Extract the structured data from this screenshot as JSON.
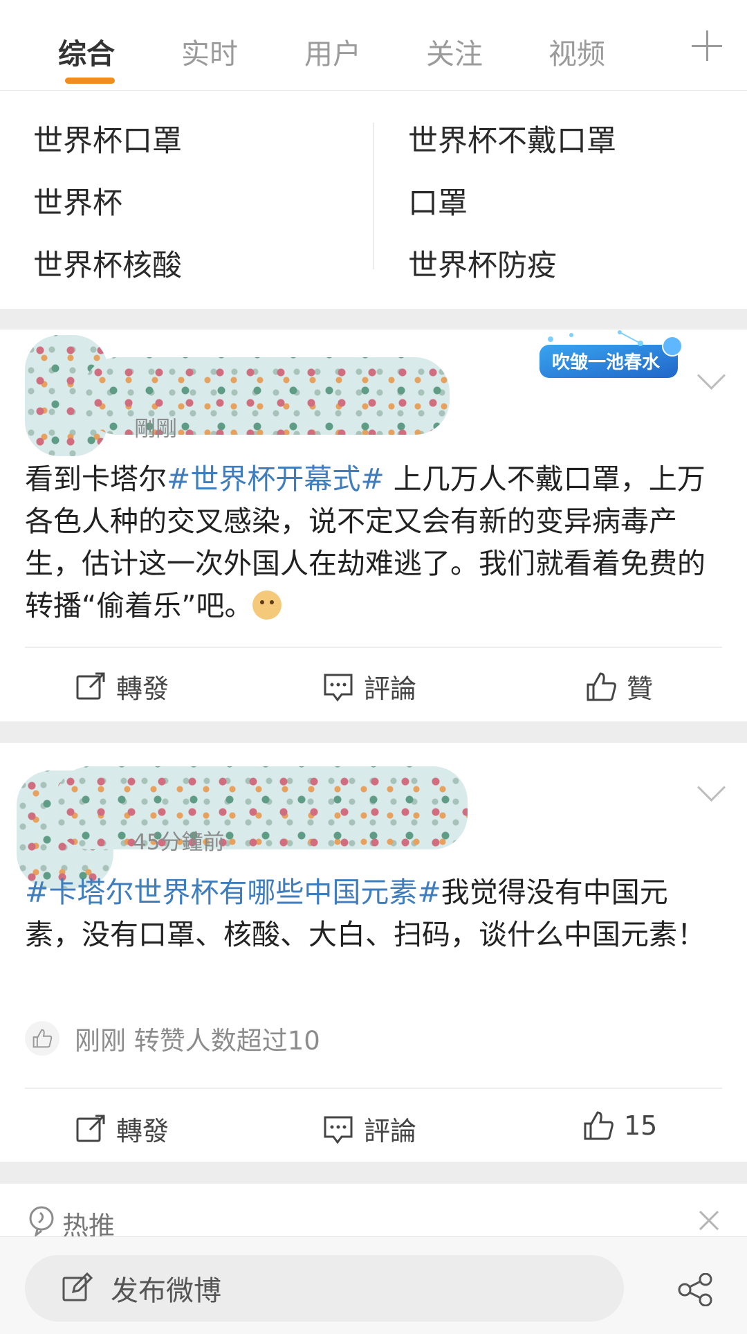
{
  "tabs": [
    {
      "label": "综合",
      "active": true
    },
    {
      "label": "实时"
    },
    {
      "label": "用户"
    },
    {
      "label": "关注"
    },
    {
      "label": "视频"
    }
  ],
  "suggestions": {
    "left": [
      "世界杯口罩",
      "世界杯",
      "世界杯核酸"
    ],
    "right": [
      "世界杯不戴口罩",
      "口罩",
      "世界杯防疫"
    ]
  },
  "posts": [
    {
      "time": "剛剛",
      "badge_text": "吹皱一池春水",
      "content_prefix": "看到卡塔尔",
      "hashtag": "#世界杯开幕式#",
      "content_suffix": " 上几万人不戴口罩，上万各色人种的交叉感染，说不定又会有新的变异病毒产生，估计这一次外国人在劫难逃了。我们就看着免费的转播“偷着乐”吧。",
      "actions": {
        "repost": "轉發",
        "comment": "評論",
        "like": "贊"
      }
    },
    {
      "time": "45分鐘前",
      "hashtag": "#卡塔尔世界杯有哪些中国元素#",
      "content_suffix": "我觉得没有中国元素，没有口罩、核酸、大白、扫码，谈什么中国元素！",
      "liked_info": "刚刚 转赞人数超过10",
      "actions": {
        "repost": "轉發",
        "comment": "評論",
        "like": "15"
      }
    }
  ],
  "hot_label": "热推",
  "compose_label": "发布微博",
  "colors": {
    "accent": "#f08d1e",
    "link": "#3f7dbd"
  }
}
